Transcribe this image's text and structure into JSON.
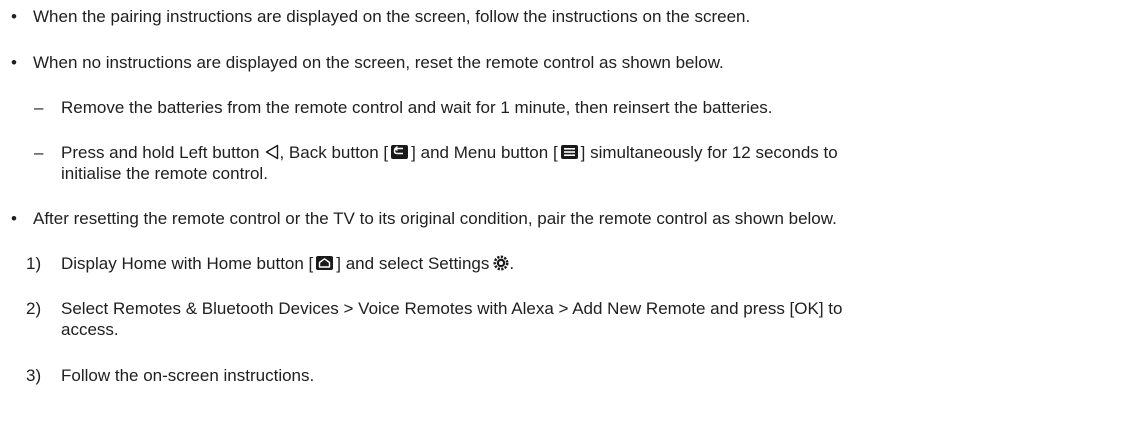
{
  "items": {
    "b1": "When the pairing instructions are displayed on the screen, follow the instructions on the screen.",
    "b2": "When no instructions are displayed on the screen, reset the remote control as shown below.",
    "d1": "Remove the batteries from the remote control and wait for 1 minute, then reinsert the batteries.",
    "d2_a": "Press and hold Left button",
    "d2_b": ", Back button [",
    "d2_c": "] and Menu button [",
    "d2_d": "] simultaneously for 12 seconds to",
    "d2_cont": "initialise the remote control.",
    "b3": "After resetting the remote control or the TV to its original condition, pair the remote control as shown below.",
    "s1_a": "Display Home with Home button [",
    "s1_b": "] and select Settings",
    "s1_c": ".",
    "s2": "Select Remotes & Bluetooth Devices > Voice Remotes with Alexa > Add New Remote and press [OK] to",
    "s2_cont": "access.",
    "s3": "Follow the on-screen instructions."
  },
  "markers": {
    "bullet": "•",
    "dash": "–",
    "n1": "1)",
    "n2": "2)",
    "n3": "3)"
  },
  "icons": [
    "left-triangle-icon",
    "back-icon",
    "menu-icon",
    "home-icon",
    "settings-gear-icon"
  ]
}
